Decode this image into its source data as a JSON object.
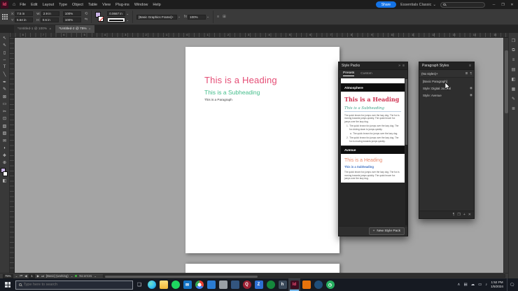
{
  "colors": {
    "accent_blue": "#1473e6",
    "doc_heading_pink": "#e54d75",
    "doc_subheading_green": "#44bd8b",
    "pack1_heading_red": "#cf3150",
    "pack1_subheading_teal": "#3c9f85",
    "pack2_heading_salmon": "#e98a6d",
    "pack2_subheading_blue": "#3e6fc1",
    "indesign_logo_pink": "#ff4f78",
    "no_errors_green": "#3fbf3f",
    "fill_swatch_lavender": "#c9b3e6"
  },
  "icons": {
    "home": "⌂",
    "menu": "≡",
    "chevron_down": "⌄",
    "minimize": "─",
    "restore": "❐",
    "close": "✕",
    "tab_close": "×",
    "collapse_left": "«",
    "collapse_right": "»",
    "plus": "+",
    "pilcrow": "¶",
    "grid": "⊞",
    "prev": "◀",
    "next": "▶",
    "first": "⏮",
    "last": "⏭",
    "fx": "fx",
    "rotate": "⟲",
    "flip": "⇋"
  },
  "titlebar": {
    "logo": "Id",
    "menus": [
      "File",
      "Edit",
      "Layout",
      "Type",
      "Object",
      "Table",
      "View",
      "Plug-ins",
      "Window",
      "Help"
    ],
    "share": "Share",
    "workspace": "Essentials Classic"
  },
  "control_bar": {
    "x_label": "X:",
    "x_value": "7.5 in",
    "y_label": "Y:",
    "y_value": "5.64 in",
    "w_label": "W:",
    "w_value": "2.9 in",
    "h_label": "H:",
    "h_value": "0.6 in",
    "scale_x": "100%",
    "scale_y": "100%",
    "stroke_weight": "0.0667 in",
    "object_style": "[Basic Graphics Frame]+",
    "opacity": "100%"
  },
  "tabs": [
    {
      "label": "*Untitled-1 @ 100%",
      "active": false
    },
    {
      "label": "*Untitled-2 @ 75%",
      "active": true
    }
  ],
  "tools": [
    {
      "name": "selection-tool",
      "glyph": "↖"
    },
    {
      "name": "direct-selection-tool",
      "glyph": "⇖"
    },
    {
      "name": "page-tool",
      "glyph": "▯"
    },
    {
      "name": "gap-tool",
      "glyph": "⇔"
    },
    {
      "name": "type-tool",
      "glyph": "T"
    },
    {
      "name": "line-tool",
      "glyph": "╲"
    },
    {
      "name": "pen-tool",
      "glyph": "✒"
    },
    {
      "name": "pencil-tool",
      "glyph": "✎"
    },
    {
      "name": "rectangle-frame-tool",
      "glyph": "⊠"
    },
    {
      "name": "rectangle-tool",
      "glyph": "▭"
    },
    {
      "name": "scissors-tool",
      "glyph": "✂"
    },
    {
      "name": "free-transform-tool",
      "glyph": "⊡"
    },
    {
      "name": "gradient-swatch-tool",
      "glyph": "▧"
    },
    {
      "name": "gradient-feather-tool",
      "glyph": "▨"
    },
    {
      "name": "note-tool",
      "glyph": "✉"
    },
    {
      "name": "eyedropper-tool",
      "glyph": "◗"
    },
    {
      "name": "hand-tool",
      "glyph": "❖"
    },
    {
      "name": "zoom-tool",
      "glyph": "⊕"
    }
  ],
  "ruler_numbers": [
    "8",
    "7",
    "6",
    "5",
    "4",
    "3",
    "2",
    "1",
    "0",
    "1",
    "2",
    "3",
    "4",
    "5",
    "6",
    "7",
    "8",
    "9",
    "10",
    "11",
    "12",
    "13",
    "14",
    "15",
    "16"
  ],
  "document": {
    "heading": "This is a Heading",
    "subheading": "This is a Subheading",
    "paragraph": "This is a Paragraph"
  },
  "style_packs": {
    "title": "Style Packs",
    "tabs": {
      "presets": "Presets",
      "custom": "Custom"
    },
    "atmosphere": {
      "name": "Atmosphere",
      "heading": "This is a Heading",
      "subheading": "This is a Subheading",
      "body": "The quick brown fox jumps over the lazy dog. The fox is moving towards jumps quickly. The quick brown fox jumps over the lazy dog.",
      "list": [
        {
          "marker": "1.",
          "ml": "3px",
          "text": "The quick brown fox jumps over the lazy dog. The fox driving down to jumps quickly."
        },
        {
          "marker": "a.",
          "ml": "8px",
          "text": "The quick brown fox jumps over the lazy dog."
        },
        {
          "marker": "2.",
          "ml": "3px",
          "text": "The quick brown fox jumps over the lazy dog. The fox is moving towards jumps quickly."
        }
      ]
    },
    "avenue": {
      "name": "Avenue",
      "heading": "This is a Heading",
      "subheading": "This is a Subheading",
      "body": "The quick brown fox jumps over the lazy dog. The fox is moving towards jumps quickly. The quick brown fox jumps over the lazy dog."
    },
    "new_button": "New Style Pack"
  },
  "paragraph_styles": {
    "title": "Paragraph Styles",
    "current": "(No styles)+",
    "items": [
      {
        "label": "[Basic Paragraph]",
        "gear": ""
      },
      {
        "label": "Style: Digital Journal",
        "gear": "◉"
      },
      {
        "label": "Style: Avenue",
        "gear": "◉"
      }
    ],
    "footer_icons": [
      {
        "name": "clear-overrides-icon",
        "glyph": "¶"
      },
      {
        "name": "style-group-icon",
        "glyph": "❐"
      },
      {
        "name": "new-style-icon",
        "glyph": "+"
      },
      {
        "name": "delete-style-icon",
        "glyph": "✕"
      }
    ]
  },
  "status_bar": {
    "zoom": "75%",
    "page": "1",
    "preflight": "[Basic] (working)",
    "errors": "No errors"
  },
  "dock_icons": [
    {
      "name": "pages-panel-icon",
      "glyph": "❐"
    },
    {
      "name": "layers-panel-icon",
      "glyph": "⧉"
    },
    {
      "name": "links-panel-icon",
      "glyph": "≡"
    },
    {
      "name": "stroke-panel-icon",
      "glyph": "▤"
    },
    {
      "name": "color-panel-icon",
      "glyph": "◧"
    },
    {
      "name": "swatches-panel-icon",
      "glyph": "▦"
    },
    {
      "name": "cc-libraries-panel-icon",
      "glyph": "✎"
    },
    {
      "name": "effects-panel-icon",
      "glyph": "≣"
    }
  ],
  "taskbar": {
    "search_placeholder": "Type here to search",
    "apps": [
      {
        "name": "taskbar-app-edge",
        "bg": "radial-gradient(circle at 35% 35%, #6fe0c8, #35c1f1 55%, #0b62a8)",
        "radius": "50%",
        "glyph": "",
        "fg": "#fff"
      },
      {
        "name": "taskbar-app-file-explorer",
        "bg": "linear-gradient(#ffdf7e, #f3b93a)",
        "radius": "2px",
        "glyph": "",
        "fg": "#fff"
      },
      {
        "name": "taskbar-app-spotify",
        "bg": "#1ed760",
        "radius": "50%",
        "glyph": "",
        "fg": "#0b0b0b"
      },
      {
        "name": "taskbar-app-mail",
        "bg": "#1574c5",
        "radius": "2px",
        "glyph": "✉",
        "fg": "#fff"
      },
      {
        "name": "taskbar-app-chrome",
        "bg": "radial-gradient(circle, #fff 0 2.5px, transparent 2.5px), conic-gradient(#ea4335 0 33%, #4285f4 33% 66%, #34a853 66% 100%)",
        "radius": "50%",
        "glyph": "",
        "fg": "#fff"
      },
      {
        "name": "taskbar-app-blue-doc",
        "bg": "#2b7cd3",
        "radius": "2px",
        "glyph": "",
        "fg": "#fff"
      },
      {
        "name": "taskbar-app-gray",
        "bg": "#9aa0a6",
        "radius": "2px",
        "glyph": "",
        "fg": "#fff"
      },
      {
        "name": "taskbar-app-navy",
        "bg": "#33557e",
        "radius": "2px",
        "glyph": "",
        "fg": "#fff"
      },
      {
        "name": "taskbar-app-q",
        "bg": "#9d2235",
        "radius": "50%",
        "glyph": "Q",
        "fg": "#fff"
      },
      {
        "name": "taskbar-app-z",
        "bg": "#2d6fd2",
        "radius": "2px",
        "glyph": "Z",
        "fg": "#fff"
      },
      {
        "name": "taskbar-app-green",
        "bg": "#15873c",
        "radius": "50%",
        "glyph": "",
        "fg": "#fff"
      },
      {
        "name": "taskbar-app-h",
        "bg": "#3b4a5a",
        "radius": "2px",
        "glyph": "h",
        "fg": "#fff"
      },
      {
        "name": "taskbar-app-indesign",
        "bg": "#3d0d20",
        "radius": "2px",
        "glyph": "Id",
        "fg": "#ff4f78",
        "active": true
      },
      {
        "name": "taskbar-app-orange",
        "bg": "#e8730c",
        "radius": "2px",
        "glyph": "",
        "fg": "#fff"
      },
      {
        "name": "taskbar-app-blue-circle",
        "bg": "#1f4e79",
        "radius": "50%",
        "glyph": "",
        "fg": "#fff"
      },
      {
        "name": "taskbar-app-clock",
        "bg": "#27ae60",
        "radius": "50%",
        "glyph": "◷",
        "fg": "#fff"
      }
    ],
    "tray": [
      {
        "name": "hidden-icons-caret",
        "glyph": "∧"
      },
      {
        "name": "tray-icon-1",
        "glyph": "▤"
      },
      {
        "name": "onedrive-icon",
        "glyph": "☁"
      },
      {
        "name": "display-icon",
        "glyph": "▭"
      },
      {
        "name": "volume-icon",
        "glyph": "♪"
      }
    ],
    "time": "1:52 PM",
    "date": "1/5/2024"
  }
}
